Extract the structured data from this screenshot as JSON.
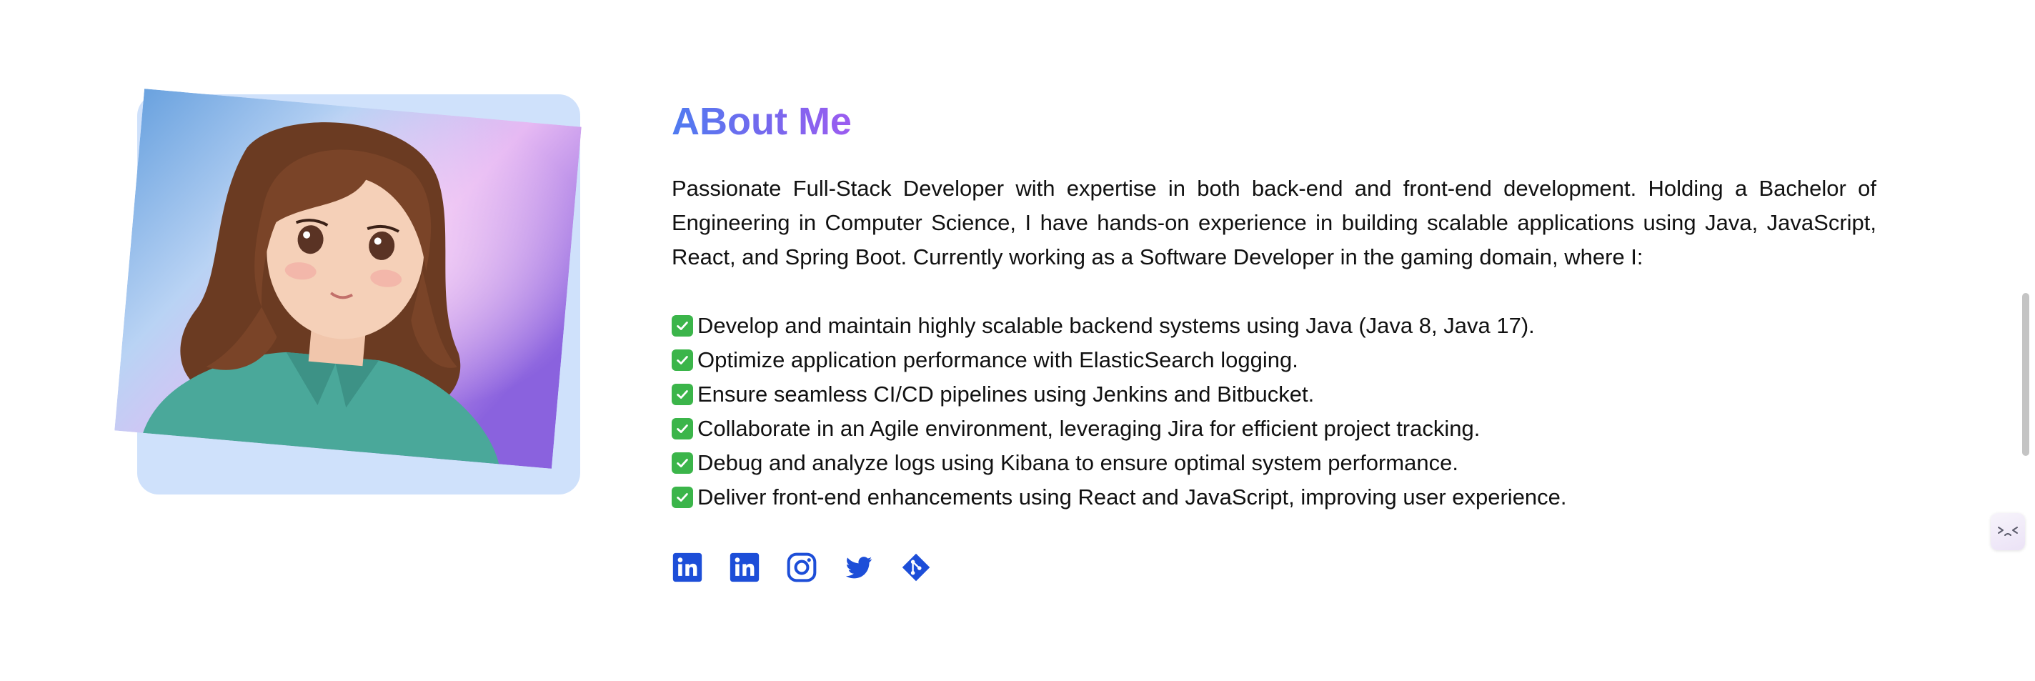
{
  "about": {
    "title": "ABout Me",
    "intro": "Passionate Full-Stack Developer with expertise in both back-end and front-end development. Holding a Bachelor of Engineering in Computer Science, I have hands-on experience in building scalable applications using Java, JavaScript, React, and Spring Boot. Currently working as a Software Developer in the gaming domain, where I:",
    "bullets": [
      "Develop and maintain highly scalable backend systems using Java (Java 8, Java 17).",
      "Optimize application performance with ElasticSearch logging.",
      "Ensure seamless CI/CD pipelines using Jenkins and Bitbucket.",
      "Collaborate in an Agile environment, leveraging Jira for efficient project tracking.",
      "Debug and analyze logs using Kibana to ensure optimal system performance.",
      "Deliver front-end enhancements using React and JavaScript, improving user experience."
    ],
    "bullet_icon": "check-mark-icon",
    "socials": [
      {
        "icon": "linkedin-icon"
      },
      {
        "icon": "linkedin-icon"
      },
      {
        "icon": "instagram-icon"
      },
      {
        "icon": "twitter-icon"
      },
      {
        "icon": "git-icon"
      }
    ]
  },
  "colors": {
    "title_gradient_start": "#4f7bf0",
    "title_gradient_end": "#9c5cf0",
    "social_icon": "#1d4ed8",
    "photo_card": "#cfe1fb",
    "check_badge": "#3bb54a"
  },
  "widgets": {
    "assistant_icon": "chat-assistant-icon"
  }
}
